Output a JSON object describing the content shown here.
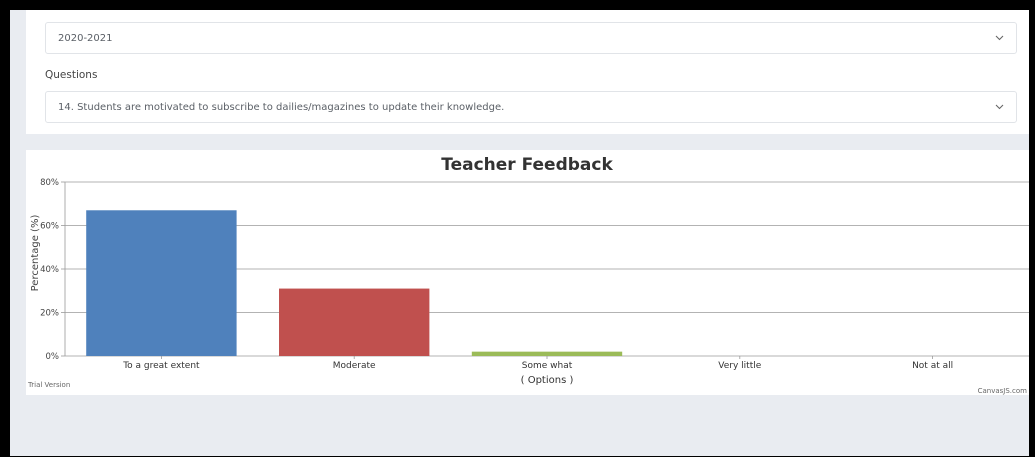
{
  "form": {
    "year": {
      "value": "2020-2021",
      "icon": "chevron-down-icon"
    },
    "questions_label": "Questions",
    "question": {
      "value": "14. Students are motivated to subscribe to dailies/magazines to update their knowledge.",
      "icon": "chevron-down-icon"
    }
  },
  "chart_data": {
    "type": "bar",
    "title": "Teacher Feedback",
    "ylabel": "Percentage (%)",
    "xlabel": "( Options )",
    "categories": [
      "To a great extent",
      "Moderate",
      "Some what",
      "Very little",
      "Not at all"
    ],
    "values": [
      67,
      31,
      2,
      0,
      0
    ],
    "colors": [
      "#4f81bc",
      "#c0504e",
      "#9bbb58",
      "#23bfaa",
      "#8064a1"
    ],
    "ylim": [
      0,
      80
    ],
    "yticks": [
      0,
      20,
      40,
      60,
      80
    ],
    "ytick_labels": [
      "0%",
      "20%",
      "40%",
      "60%",
      "80%"
    ],
    "grid": true
  },
  "watermarks": {
    "left": "Trial Version",
    "right": "CanvasJS.com"
  }
}
